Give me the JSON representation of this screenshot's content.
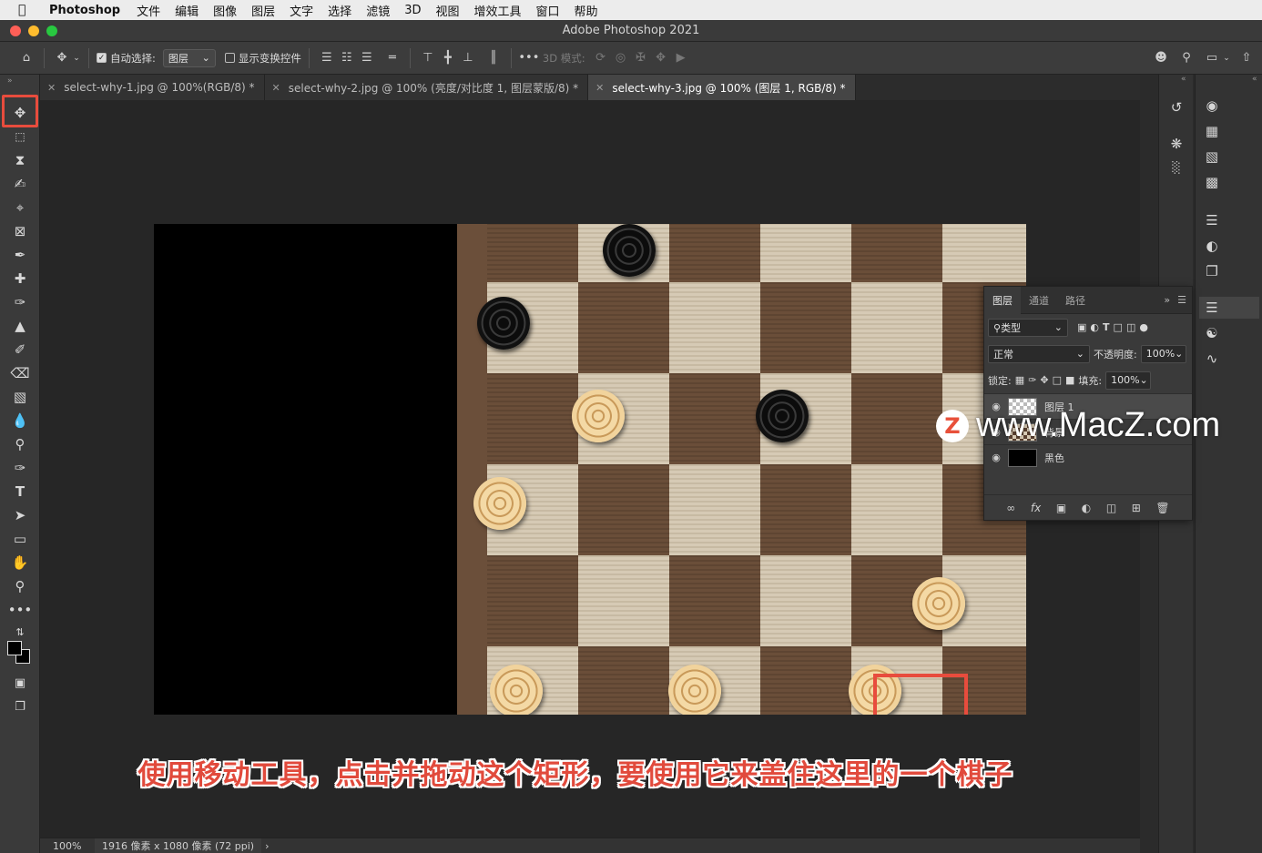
{
  "menubar": {
    "app": "Photoshop",
    "items": [
      "文件",
      "编辑",
      "图像",
      "图层",
      "文字",
      "选择",
      "滤镜",
      "3D",
      "视图",
      "增效工具",
      "窗口",
      "帮助"
    ]
  },
  "window": {
    "title": "Adobe Photoshop 2021"
  },
  "options": {
    "auto_select_label": "自动选择:",
    "auto_select_value": "图层",
    "show_transform_label": "显示变换控件",
    "mode_3d_label": "3D 模式:"
  },
  "tabs": [
    {
      "label": "select-why-1.jpg @ 100%(RGB/8) *",
      "active": false
    },
    {
      "label": "select-why-2.jpg @ 100% (亮度/对比度 1, 图层蒙版/8) *",
      "active": false
    },
    {
      "label": "select-why-3.jpg @ 100% (图层 1, RGB/8) *",
      "active": true
    }
  ],
  "caption": "使用移动工具，点击并拖动这个矩形，要使用它来盖住这里的一个棋子",
  "status": {
    "zoom": "100%",
    "doc_info": "1916 像素 x 1080 像素 (72 ppi)"
  },
  "layers_panel": {
    "tabs": [
      "图层",
      "通道",
      "路径"
    ],
    "filter_label": "类型",
    "blend_mode": "正常",
    "opacity_label": "不透明度:",
    "opacity_value": "100%",
    "lock_label": "锁定:",
    "fill_label": "填充:",
    "fill_value": "100%",
    "layers": [
      {
        "name": "图层 1"
      },
      {
        "name": "背景"
      },
      {
        "name": "黑色"
      }
    ]
  },
  "watermark": {
    "logo": "Z",
    "text": "www.MacZ.com"
  },
  "colors": {
    "highlight": "#e84c3d",
    "caption": "#e14a3c"
  }
}
